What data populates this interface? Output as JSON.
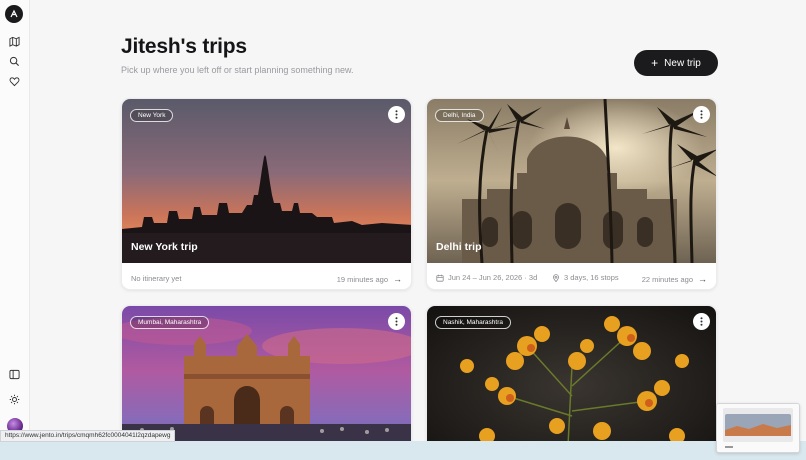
{
  "sidebar": {
    "icons": [
      "logo-icon",
      "map-icon",
      "search-icon",
      "heart-icon",
      "sidebar-panel-icon",
      "sun-icon"
    ]
  },
  "header": {
    "title": "Jitesh's trips",
    "subtitle": "Pick up where you left off or start planning something new.",
    "new_trip_label": "New trip"
  },
  "trips": [
    {
      "tag": "New York",
      "name": "New York trip",
      "itinerary": "No itinerary yet",
      "updated": "19 minutes ago"
    },
    {
      "tag": "Delhi, India",
      "name": "Delhi trip",
      "dates": "Jun 24 – Jun 26, 2026 · 3d",
      "stops": "3 days, 16 stops",
      "updated": "22 minutes ago"
    },
    {
      "tag": "Mumbai, Maharashtra"
    },
    {
      "tag": "Nashik, Maharashtra"
    }
  ],
  "status_url": "https://www.jento.in/trips/cmqmh62fc0004041l2qzdapewg",
  "colors": {
    "accent": "#1b1b1d",
    "background": "#f6f6f7"
  }
}
